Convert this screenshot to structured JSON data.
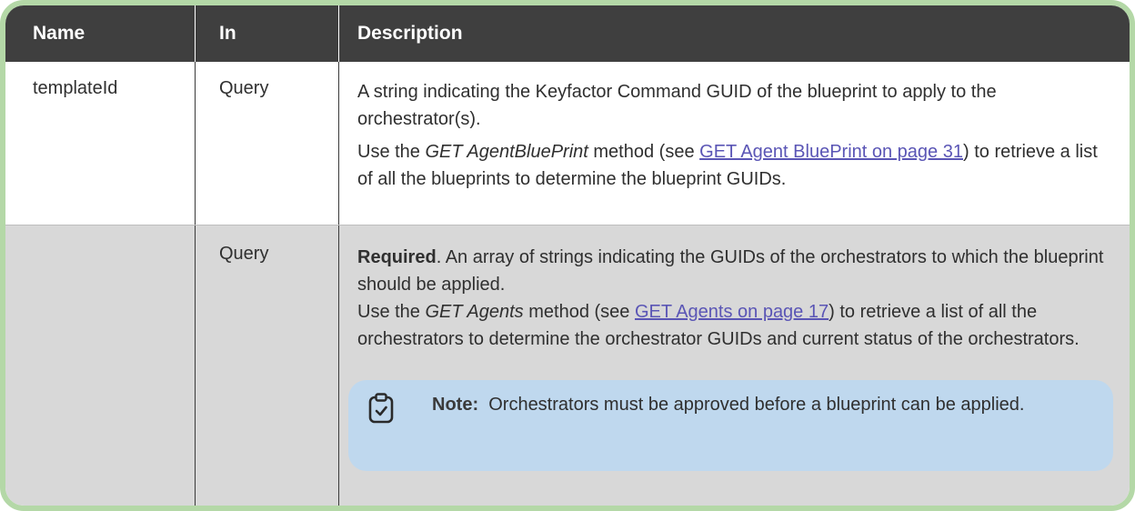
{
  "headers": {
    "name": "Name",
    "in": "In",
    "description": "Description"
  },
  "rows": [
    {
      "name": "templateId",
      "in": "Query",
      "desc_p1": "A string indicating the Keyfactor Command GUID of the blueprint to apply to the orchestrator(s).",
      "desc_p2_a": "Use the ",
      "desc_p2_method": "GET AgentBluePrint",
      "desc_p2_b": " method (see ",
      "desc_p2_link": "GET Agent BluePrint on page 31",
      "desc_p2_c": ") to retrieve a list of all the blueprints to determine the blueprint GUIDs."
    },
    {
      "name": "",
      "in": "Query",
      "desc_required": "Required",
      "desc_p1": ". An array of strings indicating the GUIDs of the orchestrators to which the blueprint should be applied.",
      "desc_p2_a": "Use the ",
      "desc_p2_method": "GET Agents",
      "desc_p2_b": " method (see ",
      "desc_p2_link": "GET Agents on page 17",
      "desc_p2_c": ") to retrieve a list of all the orchestrators to determine the orchestrator GUIDs and current status of the orchestrators.",
      "note_label": "Note:",
      "note_text": "  Orchestrators must be approved before a blueprint can be applied.",
      "note_icon": "clipboard-check-icon"
    }
  ]
}
